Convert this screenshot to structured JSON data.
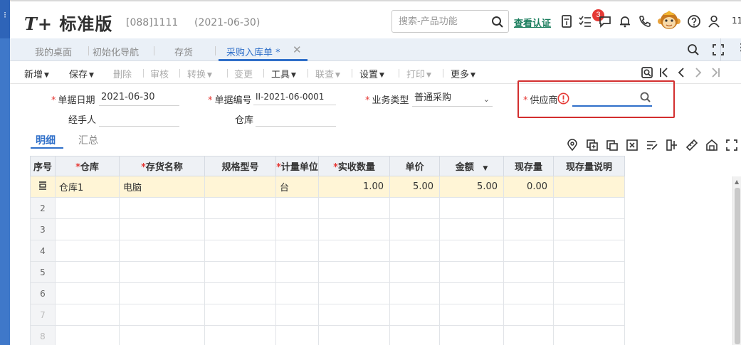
{
  "app": {
    "logo_prefix": "T+",
    "logo_text": "标准版",
    "account": "[088]1111",
    "date": "(2021-06-30)",
    "search_placeholder": "搜索-产品功能",
    "verify_link": "查看认证",
    "notification_count": "3",
    "right_number": "11"
  },
  "tabs": [
    {
      "label": "我的桌面"
    },
    {
      "label": "初始化导航"
    },
    {
      "label": "存货"
    },
    {
      "label": "采购入库单 *"
    }
  ],
  "toolbar": {
    "new": "新增",
    "save": "保存",
    "delete": "删除",
    "audit": "审核",
    "convert": "转换",
    "change": "变更",
    "tools": "工具",
    "query": "联查",
    "settings": "设置",
    "print": "打印",
    "more": "更多"
  },
  "form": {
    "doc_date_label": "单据日期",
    "doc_date_value": "2021-06-30",
    "doc_no_label": "单据编号",
    "doc_no_value": "II-2021-06-0001",
    "biz_type_label": "业务类型",
    "biz_type_value": "普通采购",
    "supplier_label": "供应商",
    "supplier_value": "",
    "handler_label": "经手人",
    "handler_value": "",
    "warehouse_label": "仓库",
    "warehouse_value": ""
  },
  "subtabs": {
    "detail": "明细",
    "summary": "汇总"
  },
  "grid": {
    "columns": [
      "序号",
      "仓库",
      "存货名称",
      "规格型号",
      "计量单位",
      "实收数量",
      "单价",
      "金额",
      "现存量",
      "现存量说明"
    ],
    "rows": [
      {
        "no": "",
        "warehouse": "仓库1",
        "item": "电脑",
        "spec": "",
        "unit": "台",
        "qty": "1.00",
        "price": "5.00",
        "amount": "5.00",
        "stock": "0.00",
        "stock_note": ""
      },
      {
        "no": "2",
        "warehouse": "",
        "item": "",
        "spec": "",
        "unit": "",
        "qty": "",
        "price": "",
        "amount": "",
        "stock": "",
        "stock_note": ""
      },
      {
        "no": "3",
        "warehouse": "",
        "item": "",
        "spec": "",
        "unit": "",
        "qty": "",
        "price": "",
        "amount": "",
        "stock": "",
        "stock_note": ""
      },
      {
        "no": "4",
        "warehouse": "",
        "item": "",
        "spec": "",
        "unit": "",
        "qty": "",
        "price": "",
        "amount": "",
        "stock": "",
        "stock_note": ""
      },
      {
        "no": "5",
        "warehouse": "",
        "item": "",
        "spec": "",
        "unit": "",
        "qty": "",
        "price": "",
        "amount": "",
        "stock": "",
        "stock_note": ""
      },
      {
        "no": "6",
        "warehouse": "",
        "item": "",
        "spec": "",
        "unit": "",
        "qty": "",
        "price": "",
        "amount": "",
        "stock": "",
        "stock_note": ""
      },
      {
        "no": "7",
        "warehouse": "",
        "item": "",
        "spec": "",
        "unit": "",
        "qty": "",
        "price": "",
        "amount": "",
        "stock": "",
        "stock_note": ""
      },
      {
        "no": "8",
        "warehouse": "",
        "item": "",
        "spec": "",
        "unit": "",
        "qty": "",
        "price": "",
        "amount": "",
        "stock": "",
        "stock_note": ""
      }
    ]
  },
  "colors": {
    "accent": "#2f6fc9",
    "brand_green": "#1a7d5d",
    "error": "#d32f2f",
    "row_highlight": "#fff5d6"
  },
  "icons": [
    "search-icon",
    "calculator-icon",
    "task-icon",
    "message-icon",
    "bell-icon",
    "phone-icon",
    "monkey-avatar",
    "help-icon",
    "user-icon",
    "fullscreen-icon",
    "scan-icon",
    "first-page-icon",
    "prev-page-icon",
    "next-page-icon",
    "last-page-icon",
    "location-icon",
    "copy-icon",
    "paste-icon",
    "delete-row-icon",
    "edit-icon",
    "split-icon",
    "ruler-icon",
    "warehouse-icon",
    "expand-icon"
  ]
}
